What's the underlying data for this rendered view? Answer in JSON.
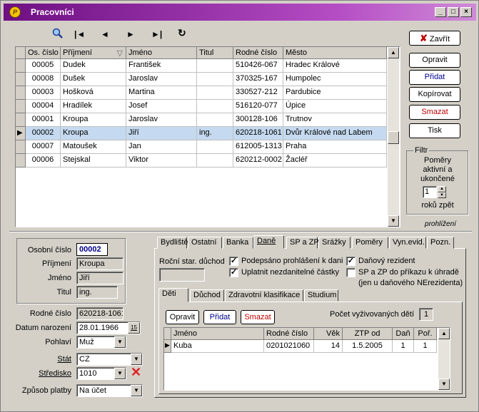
{
  "window": {
    "title": "Pracovníci",
    "icon_glyph": "P"
  },
  "toolbar": {
    "find_icon": "find-icon",
    "first": "|◄",
    "prev": "◄",
    "next": "►",
    "last": "►|",
    "refresh": "↻"
  },
  "main_grid": {
    "columns": [
      "Os. číslo",
      "Příjmení",
      "Jméno",
      "Titul",
      "Rodné číslo",
      "Město"
    ],
    "sort_indicator": "▽",
    "rows": [
      [
        "00005",
        "Dudek",
        "František",
        "",
        "510426-067",
        "Hradec Králové"
      ],
      [
        "00008",
        "Dušek",
        "Jaroslav",
        "",
        "370325-167",
        "Humpolec"
      ],
      [
        "00003",
        "Hošková",
        "Martina",
        "",
        "330527-212",
        "Pardubice"
      ],
      [
        "00004",
        "Hradílek",
        "Josef",
        "",
        "516120-077",
        "Úpice"
      ],
      [
        "00001",
        "Kroupa",
        "Jaroslav",
        "",
        "300128-106",
        "Trutnov"
      ],
      [
        "00002",
        "Kroupa",
        "Jiří",
        "ing.",
        "620218-1061",
        "Dvůr Králové nad Labem"
      ],
      [
        "00007",
        "Matoušek",
        "Jan",
        "",
        "612005-1313",
        "Praha"
      ],
      [
        "00006",
        "Stejskal",
        "Viktor",
        "",
        "620212-0002",
        "Žacléř"
      ]
    ],
    "selected_index": 5
  },
  "right_panel": {
    "close": "Zavřít",
    "edit": "Opravit",
    "add": "Přidat",
    "copy": "Kopírovat",
    "delete": "Smazat",
    "print": "Tisk",
    "filter_title": "Filtr",
    "filter_text": "Poměry aktivní a ukončené",
    "years_value": "1",
    "years_label": "roků zpět",
    "mode_label": "prohlížení"
  },
  "detail": {
    "os_cislo_label": "Osobní číslo",
    "os_cislo": "00002",
    "prijmeni_label": "Příjmení",
    "prijmeni": "Kroupa",
    "jmeno_label": "Jméno",
    "jmeno": "Jiří",
    "titul_label": "Titul",
    "titul": "ing.",
    "rodne_cislo_label": "Rodné číslo",
    "rodne_cislo": "620218-1061",
    "datum_label": "Datum narození",
    "datum": "28.01.1966",
    "calendar_icon": "15",
    "pohlavi_label": "Pohlaví",
    "pohlavi": "Muž",
    "stat_label": "Stát",
    "stat": "CZ",
    "stredisko_label": "Středisko",
    "stredisko": "1010",
    "platba_label": "Způsob platby",
    "platba": "Na účet"
  },
  "tabs": [
    "Bydliště",
    "Ostatní",
    "Banka",
    "Daně",
    "SP a ZP",
    "Srážky",
    "Poměry",
    "Vyn.evid.",
    "Pozn."
  ],
  "active_tab": 3,
  "dane": {
    "rocni_label": "Roční star. důchod",
    "podepsano": "Podepsáno prohlášení k dani",
    "podepsano_checked": true,
    "uplatnit": "Uplatnit nezdanitelné částky",
    "uplatnit_checked": true,
    "rezident": "Daňový rezident",
    "rezident_checked": true,
    "spzp": "SP a ZP do příkazu k úhradě",
    "spzp_checked": false,
    "spzp_note": "(jen u daňového NErezidenta)"
  },
  "subtabs": [
    "Děti",
    "Důchod",
    "Zdravotní klasifikace",
    "Studium"
  ],
  "deti": {
    "edit": "Opravit",
    "add": "Přidat",
    "delete": "Smazat",
    "count_label": "Počet vyživovaných dětí",
    "count": "1",
    "columns": [
      "Jméno",
      "Rodné číslo",
      "Věk",
      "ZTP od",
      "Daň",
      "Poř."
    ],
    "rows": [
      [
        "Kuba",
        "0201021060",
        "14",
        "1.5.2005",
        "1",
        "1"
      ]
    ]
  },
  "colors": {
    "title_start": "#6e0f83",
    "selected_row": "#c5daf0",
    "blue_text": "#00008b",
    "red_text": "#c00000"
  }
}
